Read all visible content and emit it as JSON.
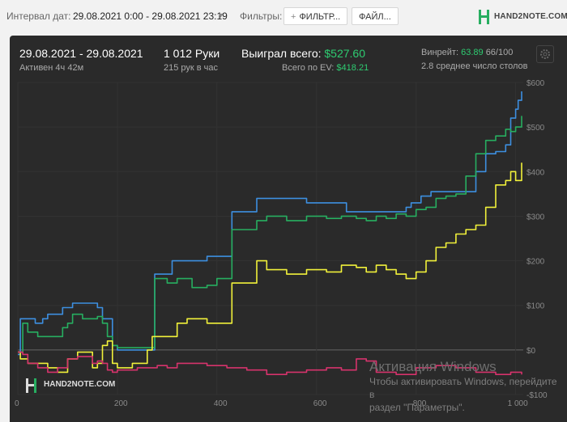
{
  "toolbar": {
    "interval_label": "Интервал дат:",
    "interval_value": "29.08.2021 0:00 - 29.08.2021 23:19",
    "filters_label": "Фильтры:",
    "filter_button": "ФИЛЬТР...",
    "file_button": "ФАЙЛ...",
    "brand": "HAND2NOTE.COM"
  },
  "summary": {
    "date_range": "29.08.2021 - 29.08.2021",
    "active": "Активен 4ч 42м",
    "hands": "1 012 Руки",
    "hands_per_hour": "215 рук в час",
    "won_label": "Выиграл всего:",
    "won_value": "$527.60",
    "ev_label": "Всего по EV:",
    "ev_value": "$418.21",
    "winrate_label": "Винрейт:",
    "winrate_value": "63.89",
    "winrate_extra": "66/100",
    "tables": "2.8 среднее число столов"
  },
  "watermark": {
    "title": "Активация Windows",
    "line1": "Чтобы активировать Windows, перейдите в",
    "line2": "раздел \"Параметры\"."
  },
  "brand_bottom": "HAND2NOTE.COM",
  "colors": {
    "bg": "#2a2a2a",
    "blue": "#3d8fe0",
    "green": "#27ae60",
    "yellow": "#f1f13a",
    "pink": "#d6336c",
    "green_text": "#2ecc71"
  },
  "chart_data": {
    "type": "line",
    "xlim": [
      0,
      1012
    ],
    "ylim": [
      -100,
      600
    ],
    "x_ticks": [
      "0",
      "200",
      "400",
      "600",
      "800",
      "1 000"
    ],
    "y_ticks": [
      "$600",
      "$500",
      "$400",
      "$300",
      "$200",
      "$100",
      "$0",
      "-$100"
    ],
    "grid": true,
    "series": [
      {
        "key": "blue",
        "color": "#3d8fe0",
        "points": [
          [
            0,
            -10
          ],
          [
            5,
            70
          ],
          [
            30,
            70
          ],
          [
            35,
            60
          ],
          [
            50,
            70
          ],
          [
            60,
            80
          ],
          [
            80,
            80
          ],
          [
            90,
            95
          ],
          [
            100,
            95
          ],
          [
            110,
            105
          ],
          [
            140,
            105
          ],
          [
            160,
            95
          ],
          [
            170,
            70
          ],
          [
            190,
            10
          ],
          [
            200,
            0
          ],
          [
            270,
            0
          ],
          [
            275,
            170
          ],
          [
            300,
            170
          ],
          [
            310,
            200
          ],
          [
            350,
            200
          ],
          [
            380,
            210
          ],
          [
            410,
            210
          ],
          [
            420,
            210
          ],
          [
            430,
            310
          ],
          [
            460,
            310
          ],
          [
            480,
            340
          ],
          [
            540,
            340
          ],
          [
            580,
            330
          ],
          [
            650,
            330
          ],
          [
            660,
            310
          ],
          [
            720,
            310
          ],
          [
            740,
            310
          ],
          [
            780,
            320
          ],
          [
            790,
            330
          ],
          [
            810,
            345
          ],
          [
            830,
            355
          ],
          [
            870,
            355
          ],
          [
            920,
            400
          ],
          [
            940,
            440
          ],
          [
            960,
            445
          ],
          [
            980,
            460
          ],
          [
            990,
            520
          ],
          [
            1000,
            540
          ],
          [
            1005,
            560
          ],
          [
            1012,
            580
          ]
        ]
      },
      {
        "key": "green",
        "color": "#27ae60",
        "points": [
          [
            0,
            -5
          ],
          [
            10,
            60
          ],
          [
            20,
            40
          ],
          [
            40,
            30
          ],
          [
            70,
            30
          ],
          [
            90,
            50
          ],
          [
            100,
            60
          ],
          [
            110,
            80
          ],
          [
            130,
            70
          ],
          [
            160,
            75
          ],
          [
            170,
            60
          ],
          [
            180,
            30
          ],
          [
            190,
            10
          ],
          [
            200,
            5
          ],
          [
            260,
            5
          ],
          [
            275,
            160
          ],
          [
            300,
            150
          ],
          [
            320,
            160
          ],
          [
            350,
            140
          ],
          [
            380,
            145
          ],
          [
            400,
            160
          ],
          [
            410,
            160
          ],
          [
            430,
            270
          ],
          [
            460,
            270
          ],
          [
            480,
            290
          ],
          [
            500,
            300
          ],
          [
            540,
            290
          ],
          [
            580,
            300
          ],
          [
            620,
            295
          ],
          [
            650,
            300
          ],
          [
            680,
            295
          ],
          [
            700,
            290
          ],
          [
            720,
            300
          ],
          [
            740,
            295
          ],
          [
            760,
            305
          ],
          [
            780,
            300
          ],
          [
            800,
            315
          ],
          [
            820,
            320
          ],
          [
            840,
            340
          ],
          [
            860,
            345
          ],
          [
            880,
            350
          ],
          [
            900,
            390
          ],
          [
            920,
            440
          ],
          [
            940,
            470
          ],
          [
            960,
            480
          ],
          [
            980,
            495
          ],
          [
            990,
            490
          ],
          [
            1000,
            500
          ],
          [
            1012,
            525
          ]
        ]
      },
      {
        "key": "yellow",
        "color": "#f1f13a",
        "points": [
          [
            0,
            -5
          ],
          [
            5,
            -20
          ],
          [
            20,
            -30
          ],
          [
            40,
            -30
          ],
          [
            60,
            -40
          ],
          [
            80,
            -50
          ],
          [
            100,
            -20
          ],
          [
            120,
            -5
          ],
          [
            140,
            -5
          ],
          [
            150,
            -40
          ],
          [
            160,
            -30
          ],
          [
            170,
            10
          ],
          [
            180,
            20
          ],
          [
            190,
            -30
          ],
          [
            200,
            -40
          ],
          [
            230,
            -30
          ],
          [
            260,
            0
          ],
          [
            270,
            30
          ],
          [
            280,
            30
          ],
          [
            300,
            30
          ],
          [
            320,
            60
          ],
          [
            340,
            70
          ],
          [
            380,
            60
          ],
          [
            410,
            60
          ],
          [
            430,
            150
          ],
          [
            460,
            150
          ],
          [
            480,
            200
          ],
          [
            500,
            180
          ],
          [
            540,
            170
          ],
          [
            580,
            180
          ],
          [
            620,
            175
          ],
          [
            650,
            190
          ],
          [
            680,
            185
          ],
          [
            700,
            175
          ],
          [
            720,
            190
          ],
          [
            740,
            180
          ],
          [
            760,
            170
          ],
          [
            780,
            160
          ],
          [
            800,
            175
          ],
          [
            820,
            200
          ],
          [
            840,
            230
          ],
          [
            860,
            240
          ],
          [
            880,
            260
          ],
          [
            900,
            270
          ],
          [
            920,
            280
          ],
          [
            940,
            320
          ],
          [
            960,
            370
          ],
          [
            980,
            380
          ],
          [
            990,
            400
          ],
          [
            1000,
            380
          ],
          [
            1012,
            420
          ]
        ]
      },
      {
        "key": "pink",
        "color": "#d6336c",
        "points": [
          [
            0,
            -5
          ],
          [
            10,
            -10
          ],
          [
            20,
            -30
          ],
          [
            40,
            -40
          ],
          [
            60,
            -50
          ],
          [
            80,
            -40
          ],
          [
            100,
            -20
          ],
          [
            120,
            -15
          ],
          [
            140,
            -15
          ],
          [
            150,
            -30
          ],
          [
            160,
            -25
          ],
          [
            170,
            -30
          ],
          [
            180,
            -45
          ],
          [
            190,
            -50
          ],
          [
            200,
            -45
          ],
          [
            240,
            -40
          ],
          [
            260,
            -40
          ],
          [
            280,
            -35
          ],
          [
            300,
            -40
          ],
          [
            320,
            -30
          ],
          [
            340,
            -30
          ],
          [
            380,
            -35
          ],
          [
            420,
            -40
          ],
          [
            460,
            -45
          ],
          [
            500,
            -55
          ],
          [
            540,
            -50
          ],
          [
            580,
            -45
          ],
          [
            620,
            -40
          ],
          [
            650,
            -45
          ],
          [
            680,
            -20
          ],
          [
            700,
            -25
          ],
          [
            720,
            -50
          ],
          [
            760,
            -55
          ],
          [
            800,
            -40
          ],
          [
            840,
            -35
          ],
          [
            880,
            -40
          ],
          [
            920,
            -50
          ],
          [
            960,
            -55
          ],
          [
            990,
            -50
          ],
          [
            1012,
            -55
          ]
        ]
      }
    ]
  }
}
